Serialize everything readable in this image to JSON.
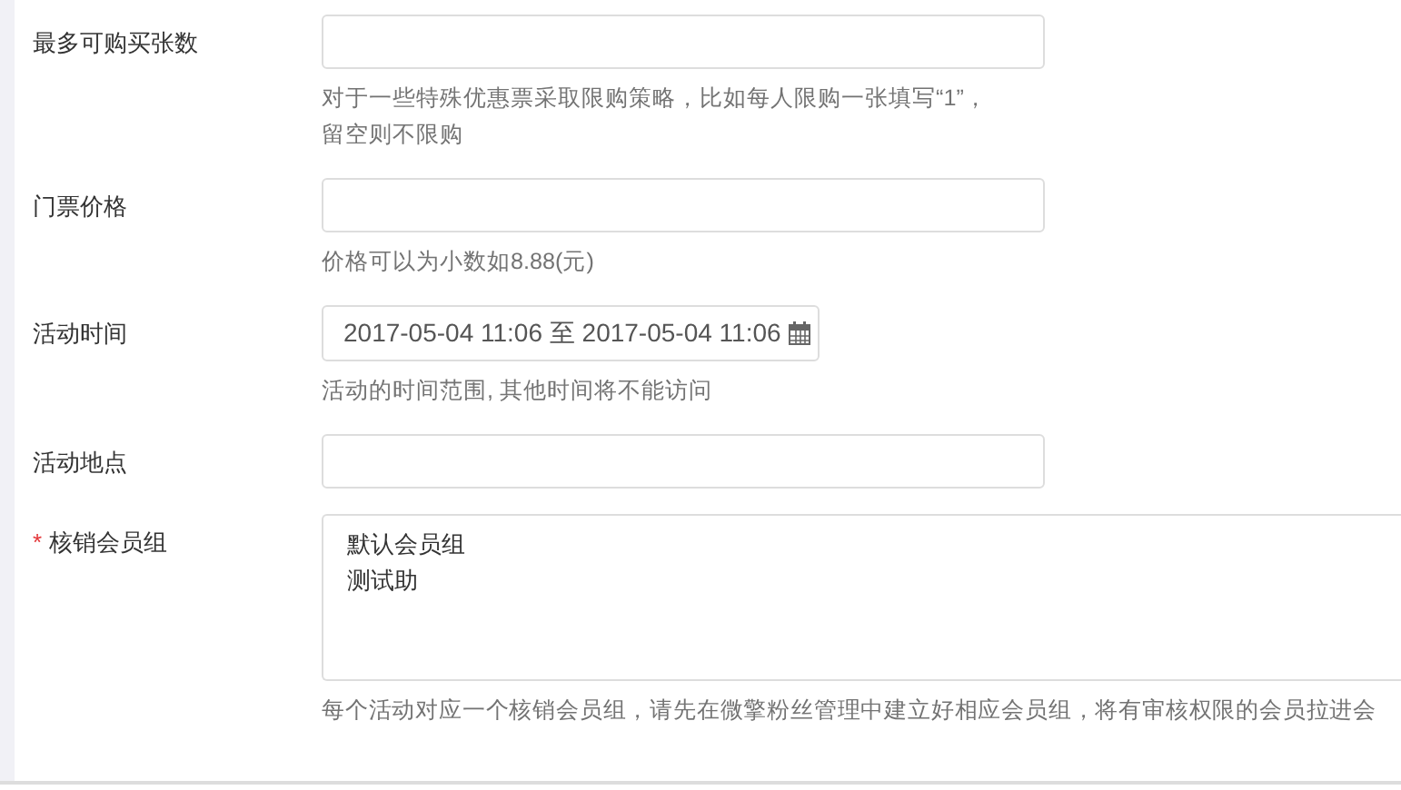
{
  "fields": [
    {
      "kind": "text",
      "label": "最多可购买张数",
      "required": false,
      "help": "对于一些特殊优惠票采取限购策略，比如每人限购一张填写“1”，留空则不限购"
    },
    {
      "kind": "text",
      "label": "门票价格",
      "required": false,
      "help": "价格可以为小数如8.88(元)"
    },
    {
      "kind": "daterange",
      "label": "活动时间",
      "required": false,
      "value": "2017-05-04 11:06 至 2017-05-04 11:06",
      "help": "活动的时间范围, 其他时间将不能访问"
    },
    {
      "kind": "text",
      "label": "活动地点",
      "required": false
    },
    {
      "kind": "multiselect",
      "label": "核销会员组",
      "required": true,
      "required_mark": "*",
      "options": [
        "默认会员组",
        "测试助"
      ],
      "help": "每个活动对应一个核销会员组，请先在微擎粉丝管理中建立好相应会员组，将有审核权限的会员拉进会"
    }
  ]
}
